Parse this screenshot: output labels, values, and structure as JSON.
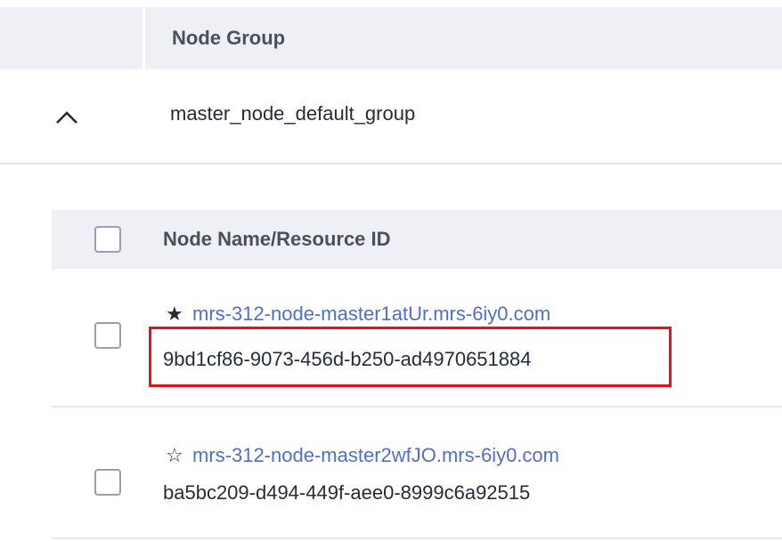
{
  "table": {
    "header": {
      "node_group": "Node Group"
    },
    "groups": [
      {
        "name": "master_node_default_group",
        "expanded": true,
        "toggle_icon": "chevron-up-icon",
        "inner_table": {
          "header": {
            "name_resource_id": "Node Name/Resource ID"
          },
          "rows": [
            {
              "star": "★",
              "star_icon": "star-filled-icon",
              "node_name": "mrs-312-node-master1atUr.mrs-6iy0.com",
              "resource_id": "9bd1cf86-9073-456d-b250-ad4970651884",
              "highlighted": true
            },
            {
              "star": "☆",
              "star_icon": "star-outline-icon",
              "node_name": "mrs-312-node-master2wfJO.mrs-6iy0.com",
              "resource_id": "ba5bc209-d494-449f-aee0-8999c6a92515",
              "highlighted": false
            }
          ]
        }
      }
    ]
  },
  "colors": {
    "header_bg": "#eef0f5",
    "link": "#526ecc",
    "highlight_border": "#e0151b",
    "divider": "#e6e8ee"
  }
}
